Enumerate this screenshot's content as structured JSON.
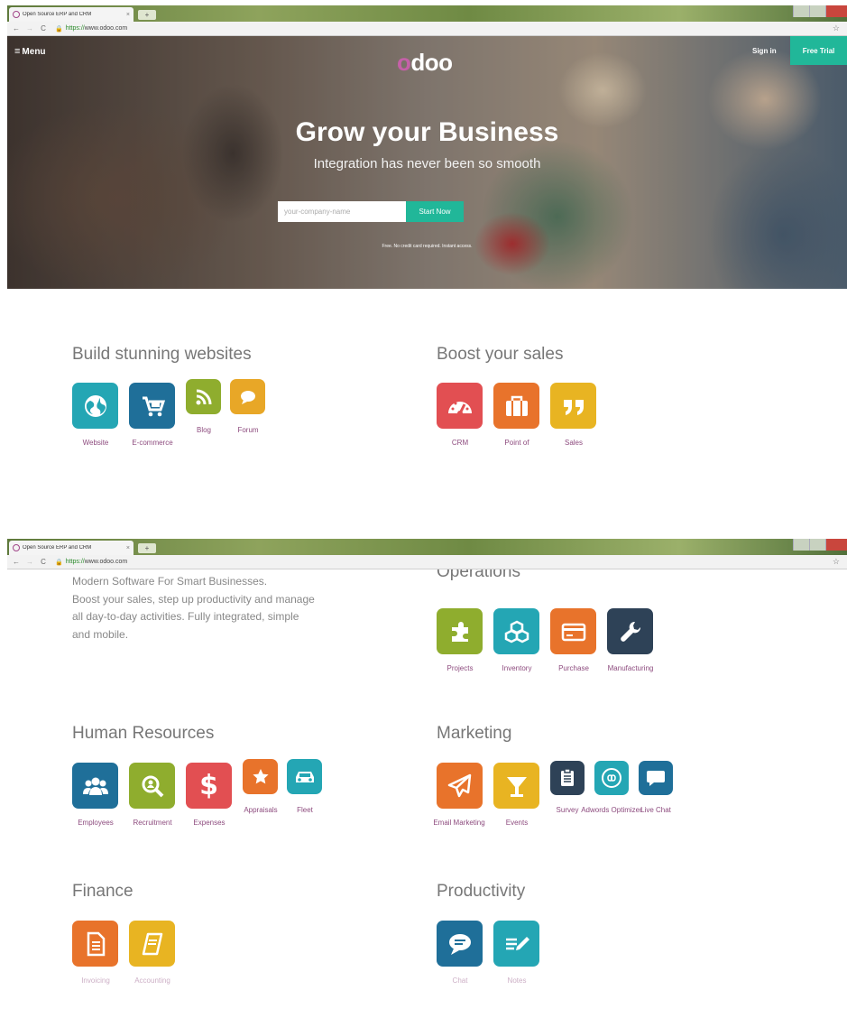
{
  "browser": {
    "tab_title": "Open Source ERP and CRM",
    "tab_close": "×",
    "new_tab": "+",
    "back": "←",
    "forward": "→",
    "reload": "C",
    "url_scheme": "https://",
    "url_host": "www.odoo.com",
    "bookmark": "☆"
  },
  "header": {
    "menu_icon": "≡",
    "menu_label": "Menu",
    "logo_o": "o",
    "logo_rest": "doo",
    "signin": "Sign in",
    "free_trial": "Free Trial"
  },
  "hero": {
    "title": "Grow your Business",
    "subtitle": "Integration has never been so smooth",
    "input_placeholder": "your-company-name",
    "start_button": "Start Now",
    "fine_print": "Free. No credit card required. Instant access."
  },
  "intro": {
    "lines": [
      "Modern Software For Smart Businesses.",
      "Boost your sales, step up productivity and manage",
      "all day-to-day activities. Fully integrated, simple",
      "and mobile."
    ]
  },
  "sections": {
    "websites": {
      "title": "Build stunning websites",
      "apps": [
        {
          "label": "Website",
          "icon": "globe-icon",
          "color": "#24a6b4"
        },
        {
          "label": "E-commerce",
          "icon": "cart-icon",
          "color": "#1f6f99"
        },
        {
          "label": "Blog",
          "icon": "rss-icon",
          "color": "#8fad2e"
        },
        {
          "label": "Forum",
          "icon": "chat-icon",
          "color": "#e8a727"
        }
      ]
    },
    "sales": {
      "title": "Boost your sales",
      "apps": [
        {
          "label": "CRM",
          "icon": "gauge-icon",
          "color": "#e24f52"
        },
        {
          "label": "Point of",
          "icon": "briefcase-icon",
          "color": "#e8732b"
        },
        {
          "label": "Sales",
          "icon": "quote-icon",
          "color": "#e8b422"
        }
      ]
    },
    "operations": {
      "title": "Operations",
      "apps": [
        {
          "label": "Projects",
          "icon": "puzzle-icon",
          "color": "#8fad2e"
        },
        {
          "label": "Inventory",
          "icon": "boxes-icon",
          "color": "#24a6b4"
        },
        {
          "label": "Purchase",
          "icon": "credit-card-icon",
          "color": "#e8732b"
        },
        {
          "label": "Manufacturing",
          "icon": "wrench-icon",
          "color": "#2e4257"
        }
      ]
    },
    "hr": {
      "title": "Human Resources",
      "apps": [
        {
          "label": "Employees",
          "icon": "people-icon",
          "color": "#1f6f99"
        },
        {
          "label": "Recruitment",
          "icon": "magnifier-icon",
          "color": "#8fad2e"
        },
        {
          "label": "Expenses",
          "icon": "dollar-icon",
          "color": "#e24f52"
        },
        {
          "label": "Appraisals",
          "icon": "star-icon",
          "color": "#e8732b"
        },
        {
          "label": "Fleet",
          "icon": "car-icon",
          "color": "#24a6b4"
        }
      ]
    },
    "marketing": {
      "title": "Marketing",
      "apps": [
        {
          "label": "Email Marketing",
          "icon": "paper-plane-icon",
          "color": "#e8732b"
        },
        {
          "label": "Events",
          "icon": "cocktail-icon",
          "color": "#e8b422"
        },
        {
          "label": "Survey",
          "icon": "clipboard-icon",
          "color": "#2e4257"
        },
        {
          "label": "Adwords Optimizer",
          "icon": "infinity-icon",
          "color": "#24a6b4"
        },
        {
          "label": "Live Chat",
          "icon": "speech-bubble-icon",
          "color": "#1f6f99"
        }
      ]
    },
    "finance": {
      "title": "Finance",
      "apps": [
        {
          "label": "Invoicing",
          "icon": "document-icon",
          "color": "#e8732b"
        },
        {
          "label": "Accounting",
          "icon": "ledger-icon",
          "color": "#e8b422"
        }
      ]
    },
    "productivity": {
      "title": "Productivity",
      "apps": [
        {
          "label": "Chat",
          "icon": "chat-bubble-icon",
          "color": "#1f6f99"
        },
        {
          "label": "Notes",
          "icon": "pencil-note-icon",
          "color": "#24a6b4"
        }
      ]
    }
  }
}
